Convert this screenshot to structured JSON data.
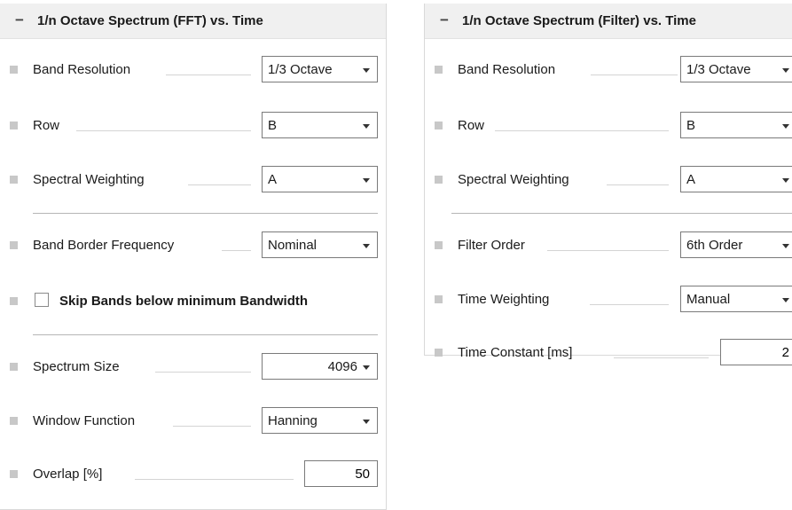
{
  "left_panel": {
    "collapse_symbol": "−",
    "title": "1/n Octave Spectrum (FFT) vs. Time",
    "band_resolution": {
      "label": "Band Resolution",
      "value": "1/3 Octave"
    },
    "row": {
      "label": "Row",
      "value": "B"
    },
    "spectral_weighting": {
      "label": "Spectral Weighting",
      "value": "A"
    },
    "band_border_frequency": {
      "label": "Band Border Frequency",
      "value": "Nominal"
    },
    "skip_bands": {
      "label": "Skip Bands below minimum Bandwidth",
      "checked": false
    },
    "spectrum_size": {
      "label": "Spectrum Size",
      "value": "4096"
    },
    "window_function": {
      "label": "Window Function",
      "value": "Hanning"
    },
    "overlap": {
      "label": "Overlap [%]",
      "value": "50"
    }
  },
  "right_panel": {
    "collapse_symbol": "−",
    "title": "1/n Octave Spectrum (Filter) vs. Time",
    "band_resolution": {
      "label": "Band Resolution",
      "value": "1/3 Octave"
    },
    "row": {
      "label": "Row",
      "value": "B"
    },
    "spectral_weighting": {
      "label": "Spectral Weighting",
      "value": "A"
    },
    "filter_order": {
      "label": "Filter Order",
      "value": "6th Order"
    },
    "time_weighting": {
      "label": "Time Weighting",
      "value": "Manual"
    },
    "time_constant": {
      "label": "Time Constant [ms]",
      "value": "2"
    }
  },
  "colors": {
    "header_bg": "#f0f0f0",
    "bullet": "#c8c8c8",
    "border": "#7a7a7a"
  }
}
